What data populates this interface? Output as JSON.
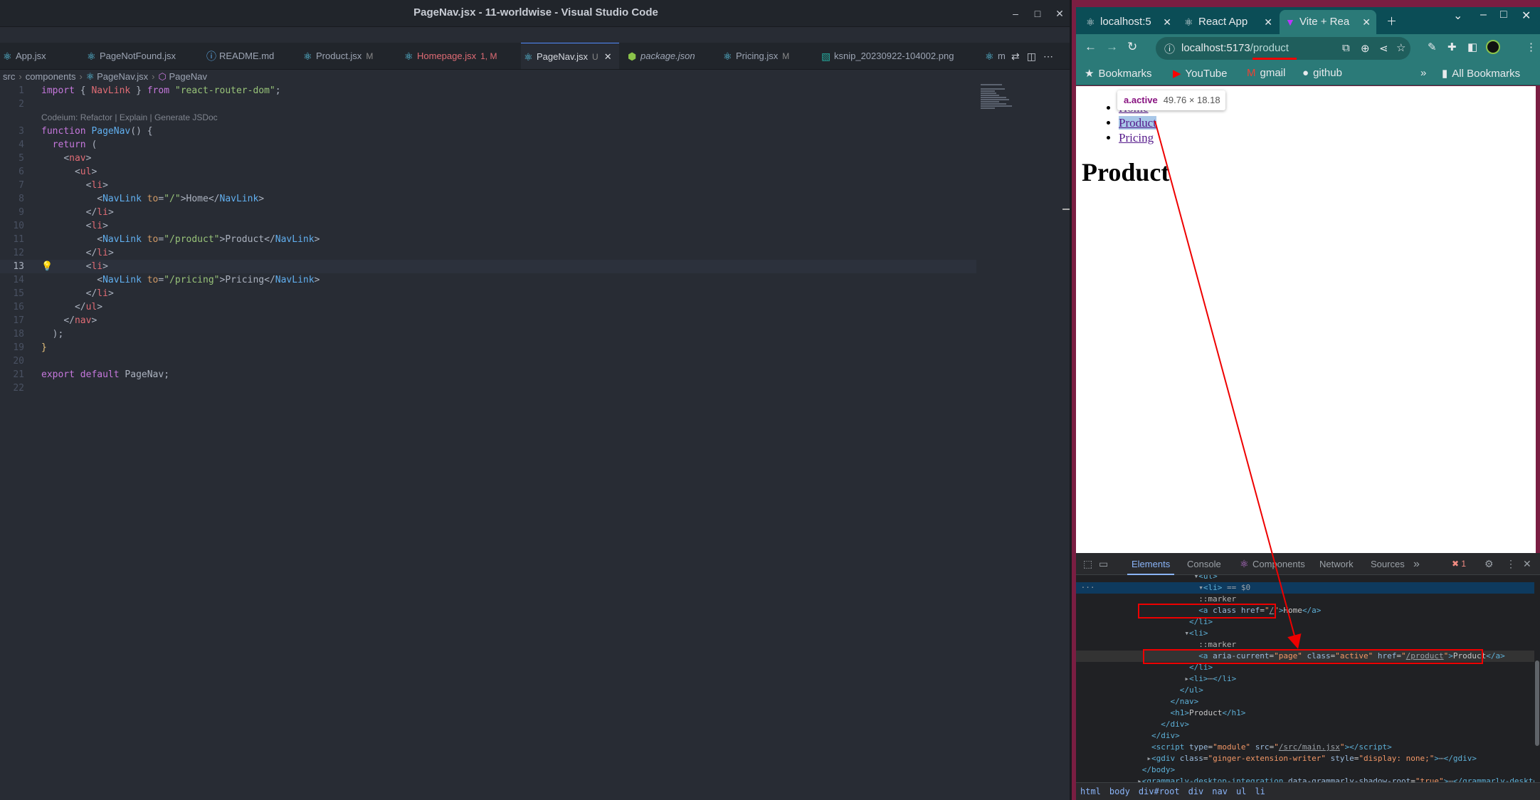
{
  "vscode": {
    "window_title": "PageNav.jsx - 11-worldwise - Visual Studio Code",
    "tabs": [
      {
        "label": "App.jsx",
        "status": "",
        "icon": "⚛",
        "color": "#61dafb"
      },
      {
        "label": "PageNotFound.jsx",
        "status": "",
        "icon": "⚛",
        "color": "#61dafb"
      },
      {
        "label": "README.md",
        "status": "",
        "icon": "ⓘ",
        "color": "#61afef"
      },
      {
        "label": "Product.jsx",
        "status": "M",
        "icon": "⚛",
        "color": "#61dafb"
      },
      {
        "label": "Homepage.jsx",
        "status": "1, M",
        "icon": "⚛",
        "color": "#61dafb"
      },
      {
        "label": "PageNav.jsx",
        "status": "U",
        "icon": "⚛",
        "color": "#61dafb"
      },
      {
        "label": "package.json",
        "status": "",
        "icon": "⬢",
        "color": "#8bc34a"
      },
      {
        "label": "Pricing.jsx",
        "status": "M",
        "icon": "⚛",
        "color": "#61dafb"
      },
      {
        "label": "ksnip_20230922-104002.png",
        "status": "",
        "icon": "▧",
        "color": "#26a69a"
      },
      {
        "label": "m",
        "status": "",
        "icon": "⚛",
        "color": "#61dafb"
      }
    ],
    "breadcrumb": {
      "seg1": "src",
      "seg2": "components",
      "seg3": "PageNav.jsx",
      "seg4": "PageNav"
    },
    "codelens": "Codeium: Refactor | Explain | Generate JSDoc",
    "line_numbers": [
      "1",
      "2",
      "3",
      "4",
      "5",
      "6",
      "7",
      "8",
      "9",
      "10",
      "11",
      "12",
      "13",
      "14",
      "15",
      "16",
      "17",
      "18",
      "19",
      "20",
      "21",
      "22"
    ],
    "code": {
      "l1": {
        "kw": "import",
        "b1": " { ",
        "name": "NavLink",
        "b2": " } ",
        "kw2": "from",
        "sp": " ",
        "str": "\"react-router-dom\"",
        "end": ";"
      },
      "l3": {
        "kw": "function",
        "sp": " ",
        "name": "PageNav",
        "rest": "() {"
      },
      "l4": {
        "indent": "  ",
        "kw": "return",
        "rest": " ("
      },
      "l5": {
        "indent": "    ",
        "open": "<",
        "tag": "nav",
        "close": ">"
      },
      "l6": {
        "indent": "      ",
        "open": "<",
        "tag": "ul",
        "close": ">"
      },
      "l7": {
        "indent": "        ",
        "open": "<",
        "tag": "li",
        "close": ">"
      },
      "l8": {
        "indent": "          ",
        "open": "<",
        "tag": "NavLink",
        "attr": " to",
        "eq": "=",
        "val": "\"/\"",
        "gt": ">",
        "text": "Home",
        "cl": "</",
        "tag2": "NavLink",
        "end": ">"
      },
      "l9": {
        "indent": "        ",
        "open": "</",
        "tag": "li",
        "close": ">"
      },
      "l10": {
        "indent": "        ",
        "open": "<",
        "tag": "li",
        "close": ">"
      },
      "l11": {
        "indent": "          ",
        "open": "<",
        "tag": "NavLink",
        "attr": " to",
        "eq": "=",
        "val": "\"/product\"",
        "gt": ">",
        "text": "Product",
        "cl": "</",
        "tag2": "NavLink",
        "end": ">"
      },
      "l12": {
        "indent": "        ",
        "open": "</",
        "tag": "li",
        "close": ">"
      },
      "l13": {
        "indent": "        ",
        "open": "<",
        "tag": "li",
        "close": ">"
      },
      "l14": {
        "indent": "          ",
        "open": "<",
        "tag": "NavLink",
        "attr": " to",
        "eq": "=",
        "val": "\"/pricing\"",
        "gt": ">",
        "text": "Pricing",
        "cl": "</",
        "tag2": "NavLink",
        "end": ">"
      },
      "l15": {
        "indent": "        ",
        "open": "</",
        "tag": "li",
        "close": ">"
      },
      "l16": {
        "indent": "      ",
        "open": "</",
        "tag": "ul",
        "close": ">"
      },
      "l17": {
        "indent": "    ",
        "open": "</",
        "tag": "nav",
        "close": ">"
      },
      "l18": {
        "indent": "  ",
        "text": ");"
      },
      "l19": {
        "text": "}"
      },
      "l21": {
        "kw": "export",
        "sp": " ",
        "kw2": "default",
        "rest": " PageNav;"
      }
    },
    "current_line": "13"
  },
  "chrome": {
    "tabs": [
      {
        "label": "localhost:5",
        "icon": "⚛"
      },
      {
        "label": "React App",
        "icon": "⚛"
      },
      {
        "label": "Vite + Rea",
        "icon": "▼"
      }
    ],
    "url_host": "localhost:5173",
    "url_path": "/product",
    "bookmarks": {
      "b1": "Bookmarks",
      "b2": "YouTube",
      "b3": "gmail",
      "b4": "github",
      "all": "All Bookmarks"
    },
    "page": {
      "tooltip_selector": "a.active",
      "tooltip_size": "49.76 × 18.18",
      "nav_links": [
        "Home",
        "Product",
        "Pricing"
      ],
      "heading": "Product"
    },
    "devtools": {
      "tabs": {
        "elements": "Elements",
        "console": "Console",
        "components": "Components",
        "network": "Network",
        "sources": "Sources",
        "more": "»"
      },
      "error_count": "1",
      "crumbs": [
        "html",
        "body",
        "div#root",
        "div",
        "nav",
        "ul",
        "li"
      ]
    }
  },
  "colors": {
    "annotation": "#e00000",
    "vscode_bg": "#282c34",
    "chrome_frame": "#2b7a78"
  }
}
